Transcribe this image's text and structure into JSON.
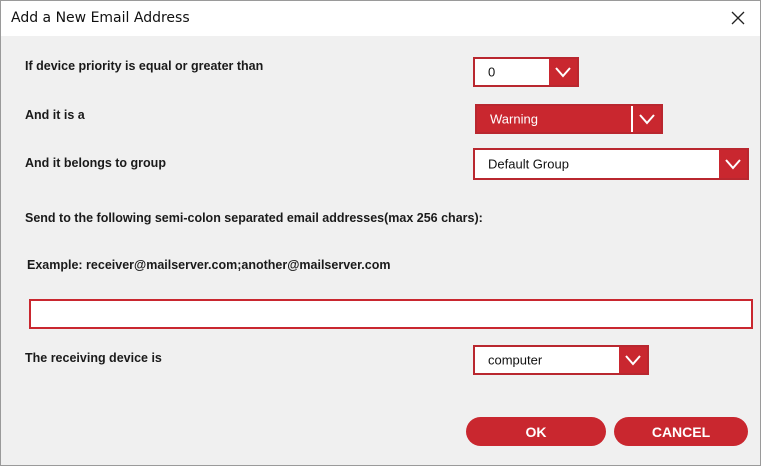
{
  "dialog": {
    "title": "Add a New Email Address",
    "close_icon": "close-icon"
  },
  "form": {
    "priority_label": "If device priority is equal or greater than",
    "priority_value": "0",
    "type_label": "And it is a",
    "type_value": "Warning",
    "group_label": "And it belongs to group",
    "group_value": "Default Group",
    "send_label": "Send to the following semi-colon separated email addresses(max 256 chars):",
    "example_text": "Example: receiver@mailserver.com;another@mailserver.com",
    "email_value": "",
    "device_label": "The receiving device is",
    "device_value": "computer"
  },
  "buttons": {
    "ok": "OK",
    "cancel": "CANCEL"
  },
  "colors": {
    "accent": "#c9272f",
    "background": "#f0f0f0"
  }
}
